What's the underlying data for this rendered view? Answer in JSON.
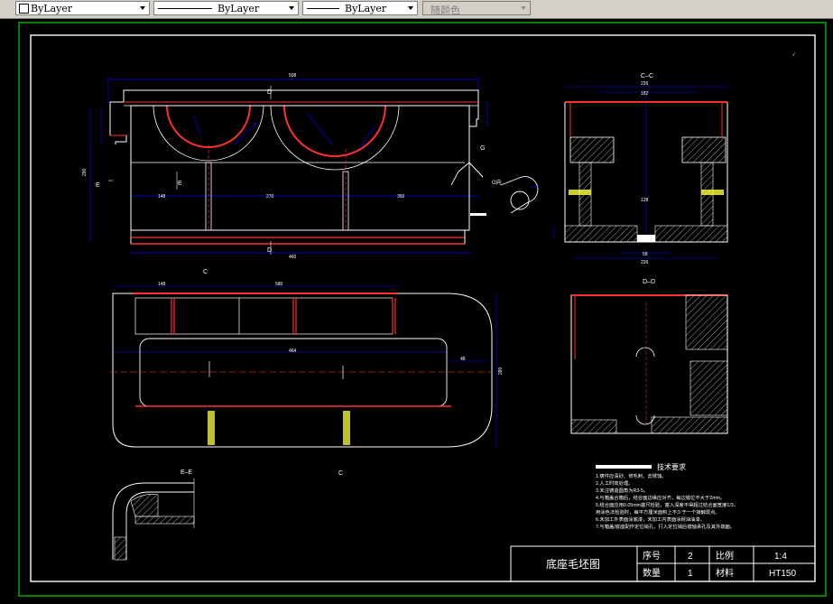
{
  "toolbar": {
    "color_combo": "ByLayer",
    "linetype_combo": "ByLayer",
    "lineweight_combo": "ByLayer",
    "plotstyle_combo": "随颜色"
  },
  "drawing": {
    "section_labels": {
      "cc": "C–C",
      "dd": "D–D",
      "ee": "E–E",
      "d": "D",
      "e": "E",
      "c": "C",
      "g": "G",
      "g_view": "G向"
    },
    "dimensions": {
      "overall_width": "508",
      "overall_bottom": "460",
      "left_span": "148",
      "mid_span": "270",
      "right_span": "350",
      "plan_left": "148",
      "plan_mid": "580",
      "plan_width": "464",
      "plan_right": "48",
      "plan_height": "280",
      "cc_top": "226",
      "cc_inner": "182",
      "cc_bottom": "226",
      "cc_mid": "128",
      "cc_base": "58",
      "height_left": "290"
    },
    "tech_requirements": {
      "title": "技术要求",
      "items": [
        "1.铸件应清砂、修毛刺、去锈蚀。",
        "2.人工时效处理。",
        "3.未注铸造圆角为R3-5。",
        "4.与箱盖合箱后，结合面边缘应对齐，每边错位不大于2mm。",
        "5.结合面应用0.05mm塞尺检验，塞入深度不得超过结合面宽度1/3，",
        "  用涂色法检验时，每平方厘米面积上不少于一个接触斑点。",
        "6.未加工外表面涂底漆，未加工内表面涂耐油油漆。",
        "7.与箱盖/底座配作定位销孔，打入定位销后镗轴承孔及其外端面。"
      ]
    },
    "title_block": {
      "name": "底座毛坯图",
      "seq_label": "序号",
      "seq_value": "2",
      "scale_label": "比例",
      "scale_value": "1:4",
      "qty_label": "数量",
      "qty_value": "1",
      "material_label": "材料",
      "material_value": "HT150"
    }
  }
}
